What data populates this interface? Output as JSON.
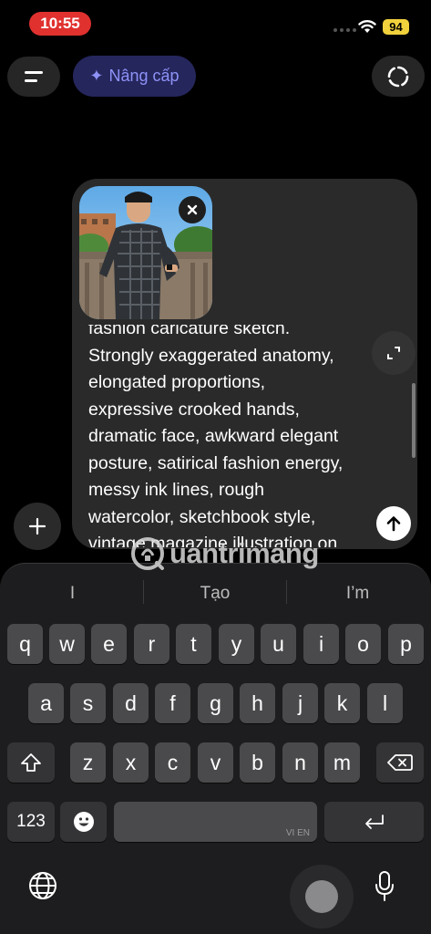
{
  "status": {
    "time": "10:55",
    "battery": "94"
  },
  "header": {
    "upgrade_label": "Nâng cấp",
    "upgrade_icon": "sparkle-icon"
  },
  "composer": {
    "prompt_lines": [
      "fashion caricature sketch.",
      "Strongly exaggerated anatomy,",
      "elongated proportions,",
      "expressive crooked hands,",
      "dramatic face, awkward elegant",
      "posture, satirical fashion energy,",
      "messy ink lines, rough",
      "watercolor, sketchbook style,",
      "vintage magazine illustration on"
    ]
  },
  "watermark": {
    "text": "uantrimang"
  },
  "keyboard": {
    "suggestions": [
      "I",
      "Tạo",
      "I’m"
    ],
    "row1": [
      "q",
      "w",
      "e",
      "r",
      "t",
      "y",
      "u",
      "i",
      "o",
      "p"
    ],
    "row2": [
      "a",
      "s",
      "d",
      "f",
      "g",
      "h",
      "j",
      "k",
      "l"
    ],
    "row3": [
      "z",
      "x",
      "c",
      "v",
      "b",
      "n",
      "m"
    ],
    "numbers_label": "123",
    "space_hint": "VI EN"
  },
  "colors": {
    "accent_upgrade": "#8e92f7",
    "time_pill": "#e0312f",
    "battery": "#f2d23c"
  }
}
